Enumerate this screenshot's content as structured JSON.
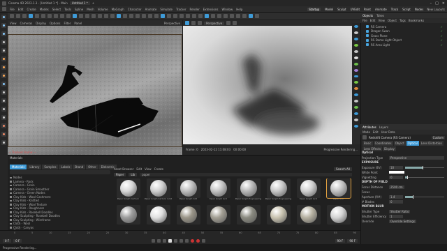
{
  "window": {
    "title": "Cinema 4D 2023.1.3 - [Untitled 1 *] - Main",
    "tabs": [
      "Untitled 1 *",
      "+"
    ],
    "controls": [
      "minimize-icon",
      "maximize-icon",
      "close-icon"
    ]
  },
  "menubar": {
    "items": [
      "File",
      "Edit",
      "Create",
      "Modes",
      "Select",
      "Tools",
      "Spline",
      "Mesh",
      "Volume",
      "MoGraph",
      "Character",
      "Animate",
      "Simulate",
      "Tracker",
      "Render",
      "Extensions",
      "Window",
      "Help"
    ],
    "layouts": [
      "Startup",
      "Model",
      "Sculpt",
      "UVEdit",
      "Paint",
      "Animate",
      "Track",
      "Script",
      "Nodes"
    ],
    "selected_layout": "Startup",
    "new_layout": "New Layouts"
  },
  "viewport1": {
    "menu": [
      "View",
      "Cameras",
      "Display",
      "Options",
      "Filter",
      "Panel"
    ],
    "camera": "Perspective",
    "status": "-- Tracked Frame: --"
  },
  "viewport2": {
    "menu_label": "Perspective",
    "frame_label": "Frame: 0",
    "timestamp": "2023-02-12 11:08:03",
    "time": "00:00:00",
    "progress": "Progressive Rendering..."
  },
  "objects": {
    "tabs": [
      "Objects",
      "Takes"
    ],
    "menu": [
      "File",
      "Edit",
      "View",
      "Object",
      "Tags",
      "Bookmarks"
    ],
    "rows": [
      {
        "label": "RS Camera",
        "check": "✓"
      },
      {
        "label": "Dragon Swan",
        "check": "✓"
      },
      {
        "label": "Grass Plane",
        "check": "✓"
      },
      {
        "label": "RS Dome Light Object",
        "check": "✓"
      },
      {
        "label": "RS Area Light",
        "check": "✓"
      }
    ]
  },
  "attributes": {
    "tabs": [
      "Attributes",
      "Layers"
    ],
    "menu": [
      "Mode",
      "Edit",
      "User Data"
    ],
    "title": "Redshift Camera (RS Camera)",
    "preset": "Custom",
    "obj_tabs": [
      "Basic",
      "Coordinates",
      "Object",
      "Optical",
      "Lens Distortion",
      "Lens Effects",
      "Display"
    ],
    "selected_tab": "Optical",
    "optical_title": "Optical",
    "projection": {
      "label": "Projection Type",
      "value": "Perspective"
    },
    "exposure": "EXPOSURE",
    "exposure_rows": [
      {
        "label": "Exposure (EV)",
        "value": "10",
        "fill": 0.45
      },
      {
        "label": "White Point",
        "value": ""
      },
      {
        "label": "Vignetting",
        "value": "0",
        "fill": 0.05
      }
    ],
    "dof": "DEPTH OF FIELD",
    "dof_rows": [
      {
        "label": "Focus Distance",
        "value": "2500 cm"
      },
      {
        "label": "Focus",
        "value": ""
      },
      {
        "label": "Aperture (f/#)",
        "value": "1.4",
        "fill": 0.2
      },
      {
        "label": "# Blades",
        "value": "0"
      }
    ],
    "motion_blur": "MOTION BLUR",
    "mb_rows": [
      {
        "label": "Shutter Type",
        "value": "Shutter Ratio"
      },
      {
        "label": "Shutter Efficiency",
        "value": "1"
      },
      {
        "label": "Override",
        "value": "Override Settings"
      }
    ]
  },
  "materials": {
    "title": "Materials",
    "tabs": [
      "Materials",
      "Library",
      "Samples",
      "Labels",
      "Brand",
      "Other",
      "Dielectric"
    ],
    "selected_tab": "Materials",
    "library": [
      "Nodes",
      "Lamera - Rock",
      "Camera - Grain",
      "Camera - Grain Smoother",
      "Camera - Green Nodes",
      "Clay Kids - Wool Cashmere",
      "Clay Kids - Knitted",
      "Clay Kids - Wool Texture",
      "Clay Kids - Roughness",
      "Clay Kids - Rosebell Doodles",
      "Clay Sculpting - Rosebell Doodles",
      "Clay Sculpting - Wireframe",
      "Cloth - Wool",
      "Cloth - Canvas",
      "Cloth - Leather",
      "Cloth - Bestfit"
    ],
    "asset_label": "Asset Browser",
    "asset_menu": [
      "Edit",
      "View",
      "Create"
    ],
    "filter_value": "paper",
    "search_all": "Search All",
    "filter_tags": [
      "Paper",
      "Lib"
    ],
    "assets": [
      {
        "caption": "Paper Graph Cartoon",
        "tone": "#d8d8d8",
        "selected": false
      },
      {
        "caption": "Paper Graph Cartoon Gold",
        "tone": "#cfcfcf",
        "selected": false
      },
      {
        "caption": "Paper Graph Cdd",
        "tone": "#bdbdbd",
        "selected": false
      },
      {
        "caption": "Paper Graph Grid",
        "tone": "#c4c4c4",
        "selected": false
      },
      {
        "caption": "Paper Graph Engineering",
        "tone": "#b8b8b8",
        "selected": false
      },
      {
        "caption": "Paper Graph Engineering",
        "tone": "#c8c8c8",
        "selected": false
      },
      {
        "caption": "Paper Graph Grid",
        "tone": "#d0d0d0",
        "selected": false
      },
      {
        "caption": "Paper Grid",
        "tone": "#c1c1c1",
        "selected": true
      },
      {
        "caption": "",
        "tone": "#9c9c9c",
        "selected": false
      },
      {
        "caption": "",
        "tone": "#e0e0e0",
        "selected": false
      },
      {
        "caption": "",
        "tone": "#9a9588",
        "selected": false
      },
      {
        "caption": "",
        "tone": "#a29e93",
        "selected": false
      },
      {
        "caption": "",
        "tone": "#8a8a80",
        "selected": false
      },
      {
        "caption": "",
        "tone": "#c9c3b0",
        "selected": false
      },
      {
        "caption": "",
        "tone": "#b5b0a0",
        "selected": false
      },
      {
        "caption": "",
        "tone": "#d4d4d4",
        "selected": false
      }
    ]
  },
  "timeline": {
    "ticks": [
      "0",
      "5",
      "10",
      "15",
      "20",
      "25",
      "30",
      "35",
      "40",
      "45",
      "50",
      "55",
      "60",
      "65",
      "70",
      "75",
      "80",
      "85",
      "90"
    ],
    "start": "0 F",
    "end": "90 F",
    "current": "0 F",
    "end_frame": "90 F"
  },
  "colors": {
    "accent": "#3e9bd8",
    "record": "#cc3333"
  }
}
